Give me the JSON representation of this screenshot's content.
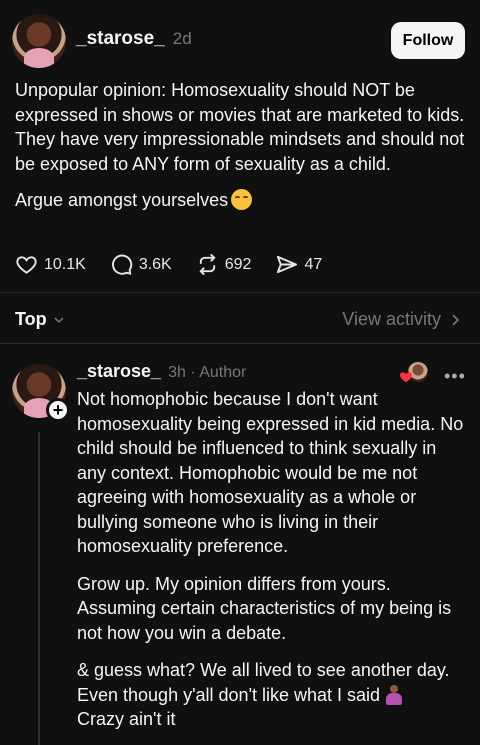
{
  "post": {
    "username": "_starose_",
    "time": "2d",
    "follow_label": "Follow",
    "paragraphs": [
      "Unpopular opinion: Homosexuality should NOT be expressed in shows or movies that are marketed to kids. They have very impressionable mindsets and should not be exposed to ANY form of sexuality as a child.",
      "Argue amongst yourselves"
    ],
    "stats": {
      "likes": "10.1K",
      "comments": "3.6K",
      "reposts": "692",
      "shares": "47"
    }
  },
  "sortbar": {
    "sort_label": "Top",
    "view_activity_label": "View activity"
  },
  "reply": {
    "username": "_starose_",
    "time": "3h · Author",
    "more_label": "•••",
    "paragraphs": [
      "Not homophobic because I don't want homosexuality being expressed in kid media. No child should be influenced to think sexually in any context. Homophobic would be me not agreeing with homosexuality as a whole or bullying someone who is living in their homosexuality preference.",
      "Grow up. My opinion differs from yours. Assuming certain characteristics of my being is not how you win a debate.",
      "& guess what? We all lived to see another day. Even though y'all don't like what I said",
      "Crazy ain't it"
    ]
  },
  "icons": {
    "heart": "heart-icon",
    "comment": "comment-icon",
    "repost": "repost-icon",
    "share": "send-icon",
    "emoji_post": "relieved-face-emoji",
    "emoji_reply": "shrug-emoji"
  }
}
